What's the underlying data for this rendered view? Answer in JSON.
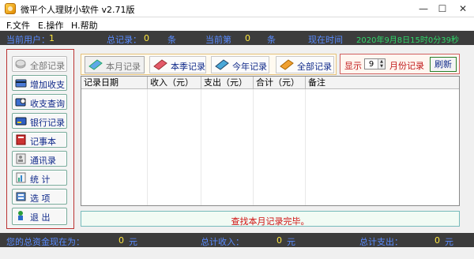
{
  "window": {
    "title": "微平个人理财小软件 v2.71版"
  },
  "menu": {
    "file": "F.文件",
    "ops": "E.操作",
    "help": "H.帮助"
  },
  "top_status": {
    "user_label": "当前用户：",
    "user_value": "1",
    "total_label": "总记录：",
    "total_value": "0",
    "total_unit": "条",
    "current_label": "当前第",
    "current_value": "0",
    "current_unit": "条",
    "time_label": "现在时间",
    "time_value": "2020年9月8日15时0分39秒"
  },
  "sidebar": {
    "all_records": "全部记录",
    "add_income": "增加收支",
    "query": "收支查询",
    "bank": "银行记录",
    "notes": "记事本",
    "contacts": "通讯录",
    "stats": "统  计",
    "options": "选  项",
    "exit": "退  出"
  },
  "toolbar": {
    "this_month": "本月记录",
    "this_season": "本季记录",
    "this_year": "今年记录",
    "all": "全部记录"
  },
  "month_filter": {
    "show_label": "显示",
    "month_value": "9",
    "suffix": "月份记录",
    "refresh": "刷新"
  },
  "table": {
    "headers": [
      "记录日期",
      "收入（元）",
      "支出（元）",
      "合计（元）",
      "备注"
    ],
    "rows": []
  },
  "message": "查找本月记录完毕。",
  "bottom_status": {
    "asset_label": "您的总资金现在为：",
    "asset_value": "0",
    "asset_unit": "元",
    "income_label": "总计收入：",
    "income_value": "0",
    "income_unit": "元",
    "expense_label": "总计支出：",
    "expense_value": "0",
    "expense_unit": "元"
  },
  "colors": {
    "status_bg": "#3c3c3c",
    "status_label": "#5a8cff",
    "status_value": "#ffe840",
    "time": "#2fd86a",
    "message": "#d01010"
  }
}
